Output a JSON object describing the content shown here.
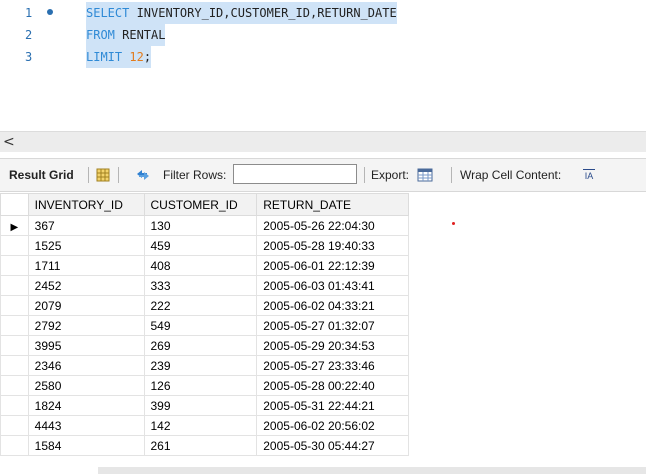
{
  "editor": {
    "lines": [
      {
        "number": "1",
        "keyword": "SELECT",
        "rest": " INVENTORY_ID,CUSTOMER_ID,RETURN_DATE",
        "has_marker": true
      },
      {
        "number": "2",
        "keyword": "FROM",
        "rest": " RENTAL",
        "has_marker": false
      },
      {
        "number": "3",
        "keyword": "LIMIT",
        "rest": " ",
        "number_value": "12",
        "suffix": ";",
        "has_marker": false
      }
    ]
  },
  "toolbar": {
    "result_grid_label": "Result Grid",
    "filter_rows_label": "Filter Rows:",
    "filter_value": "",
    "export_label": "Export:",
    "wrap_label": "Wrap Cell Content:",
    "wrap_icon_text": "IA"
  },
  "scrollbar": {
    "left_arrow": "<"
  },
  "grid": {
    "columns": [
      "INVENTORY_ID",
      "CUSTOMER_ID",
      "RETURN_DATE"
    ],
    "rows": [
      [
        "367",
        "130",
        "2005-05-26 22:04:30"
      ],
      [
        "1525",
        "459",
        "2005-05-28 19:40:33"
      ],
      [
        "1711",
        "408",
        "2005-06-01 22:12:39"
      ],
      [
        "2452",
        "333",
        "2005-06-03 01:43:41"
      ],
      [
        "2079",
        "222",
        "2005-06-02 04:33:21"
      ],
      [
        "2792",
        "549",
        "2005-05-27 01:32:07"
      ],
      [
        "3995",
        "269",
        "2005-05-29 20:34:53"
      ],
      [
        "2346",
        "239",
        "2005-05-27 23:33:46"
      ],
      [
        "2580",
        "126",
        "2005-05-28 00:22:40"
      ],
      [
        "1824",
        "399",
        "2005-05-31 22:44:21"
      ],
      [
        "4443",
        "142",
        "2005-06-02 20:56:02"
      ],
      [
        "1584",
        "261",
        "2005-05-30 05:44:27"
      ]
    ],
    "current_row_marker": "▶"
  }
}
